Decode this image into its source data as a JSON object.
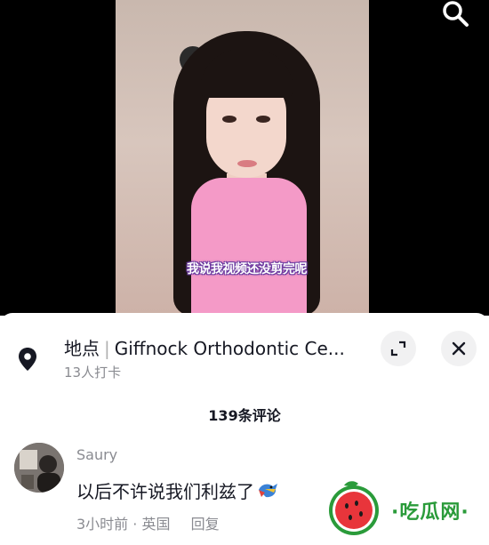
{
  "subtitle": "我说我视频还没剪完呢",
  "location": {
    "label": "地点",
    "name": "Giffnock Orthodontic Ce...",
    "checkins": "13人打卡"
  },
  "comments": {
    "count_label": "139条评论",
    "items": [
      {
        "username": "Saury",
        "text": "以后不许说我们利兹了",
        "time": "3小时前",
        "region": "英国",
        "reply_label": "回复"
      }
    ]
  },
  "watermark": {
    "text": "·吃瓜网·"
  },
  "icons": {
    "search": "search-icon",
    "location": "location-pin-icon",
    "expand": "expand-icon",
    "close": "close-icon",
    "emoji": "parrot-emoji-icon",
    "watermark": "watermelon-icon"
  },
  "colors": {
    "primary_text": "#161823",
    "secondary_text": "#8a8b91",
    "sweater_pink": "#f49ac7",
    "watermark_green": "#2a9b3a"
  }
}
